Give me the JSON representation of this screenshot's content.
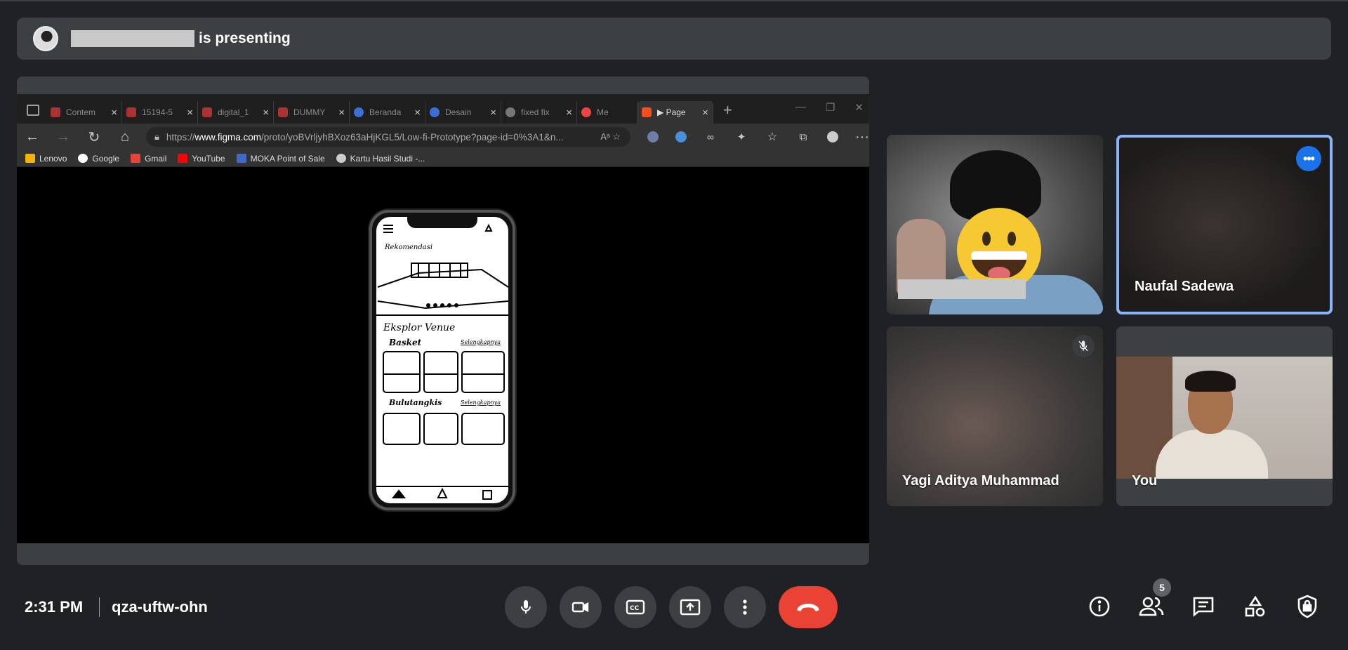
{
  "banner": {
    "presenting_text": "is presenting"
  },
  "browser": {
    "tabs": [
      {
        "label": "Contem",
        "color": "#a33"
      },
      {
        "label": "15194-5",
        "color": "#a33"
      },
      {
        "label": "digital_1",
        "color": "#a33"
      },
      {
        "label": "DUMMY",
        "color": "#a33"
      },
      {
        "label": "Beranda",
        "color": "#3b6fd6"
      },
      {
        "label": "Desain",
        "color": "#3b6fd6"
      },
      {
        "label": "fixed fix",
        "color": "#777"
      },
      {
        "label": "Me",
        "color": "#e44"
      },
      {
        "label": "▶ Page",
        "color": "#f24e1e"
      }
    ],
    "url_prefix": "https://",
    "url_host": "www.figma.com",
    "url_path": "/proto/yoBVrljyhBXoz63aHjKGL5/Low-fi-Prototype?page-id=0%3A1&n...",
    "bookmarks": [
      {
        "label": "Lenovo",
        "color": "#f4b400"
      },
      {
        "label": "Google",
        "color": "#fff"
      },
      {
        "label": "Gmail",
        "color": "#ea4335"
      },
      {
        "label": "YouTube",
        "color": "#ff0000"
      },
      {
        "label": "MOKA Point of Sale",
        "color": "#3f6bc6"
      },
      {
        "label": "Kartu Hasil Studi -...",
        "color": "#ccc"
      }
    ],
    "sketch": {
      "rekomendasi": "Rekomendasi",
      "eksplor": "Eksplor Venue",
      "basket": "Basket",
      "selengkapnya": "Selengkapnya",
      "bulutangkis": "Bulutangkis",
      "selengkapnya2": "Selengkapnya"
    }
  },
  "participants": [
    {
      "name": ""
    },
    {
      "name": "Naufal Sadewa"
    },
    {
      "name": "Yagi Aditya Muhammad"
    },
    {
      "name": "You"
    }
  ],
  "meeting": {
    "time": "2:31 PM",
    "code": "qza-uftw-ohn",
    "participant_count": "5"
  },
  "colors": {
    "accent": "#8ab4f8",
    "end_call": "#ea4335",
    "more_button": "#1a73e8"
  }
}
